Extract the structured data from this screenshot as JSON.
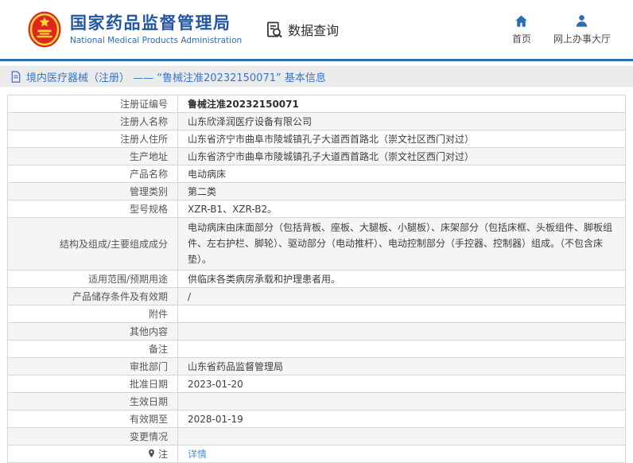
{
  "header": {
    "title": "国家药品监督管理局",
    "subtitle": "National Medical Products Administration",
    "section_label": "数据查询",
    "nav": [
      {
        "label": "首页",
        "icon": "home-icon"
      },
      {
        "label": "网上办事大厅",
        "icon": "person-icon"
      }
    ]
  },
  "breadcrumb": {
    "text": "境内医疗器械（注册） —— “鲁械注准20232150071” 基本信息"
  },
  "table": {
    "rows": [
      {
        "label": "注册证编号",
        "value": "鲁械注准20232150071",
        "bold": true
      },
      {
        "label": "注册人名称",
        "value": "山东欣泽润医疗设备有限公司"
      },
      {
        "label": "注册人住所",
        "value": "山东省济宁市曲阜市陵城镇孔子大道西首路北（崇文社区西门对过）"
      },
      {
        "label": "生产地址",
        "value": "山东省济宁市曲阜市陵城镇孔子大道西首路北（崇文社区西门对过）"
      },
      {
        "label": "产品名称",
        "value": "电动病床"
      },
      {
        "label": "管理类别",
        "value": "第二类"
      },
      {
        "label": "型号规格",
        "value": "XZR-B1、XZR-B2。"
      },
      {
        "label": "结构及组成/主要组成成分",
        "value": "电动病床由床面部分（包括背板、座板、大腿板、小腿板）、床架部分（包括床框、头板组件、脚板组件、左右护栏、脚轮）、驱动部分（电动推杆）、电动控制部分（手控器、控制器）组成。（不包含床垫）。",
        "multiline": true
      },
      {
        "label": "适用范围/预期用途",
        "value": "供临床各类病房承载和护理患者用。"
      },
      {
        "label": "产品储存条件及有效期",
        "value": "/"
      },
      {
        "label": "附件",
        "value": ""
      },
      {
        "label": "其他内容",
        "value": ""
      },
      {
        "label": "备注",
        "value": ""
      },
      {
        "label": "审批部门",
        "value": "山东省药品监督管理局"
      },
      {
        "label": "批准日期",
        "value": "2023-01-20"
      },
      {
        "label": "生效日期",
        "value": ""
      },
      {
        "label": "有效期至",
        "value": "2028-01-19"
      },
      {
        "label": "变更情况",
        "value": ""
      },
      {
        "label": "注",
        "value": "详情",
        "link": true,
        "label_icon": "pin-icon"
      }
    ]
  },
  "colors": {
    "brand_blue": "#2456a4",
    "nav_blue": "#2e6cb5",
    "link_blue": "#4a90d9",
    "breadcrumb_blue": "#3577c9",
    "emblem_red": "#e0261c",
    "emblem_gold": "#f8d43c",
    "row_alt_gray": "#f5f5f6"
  }
}
